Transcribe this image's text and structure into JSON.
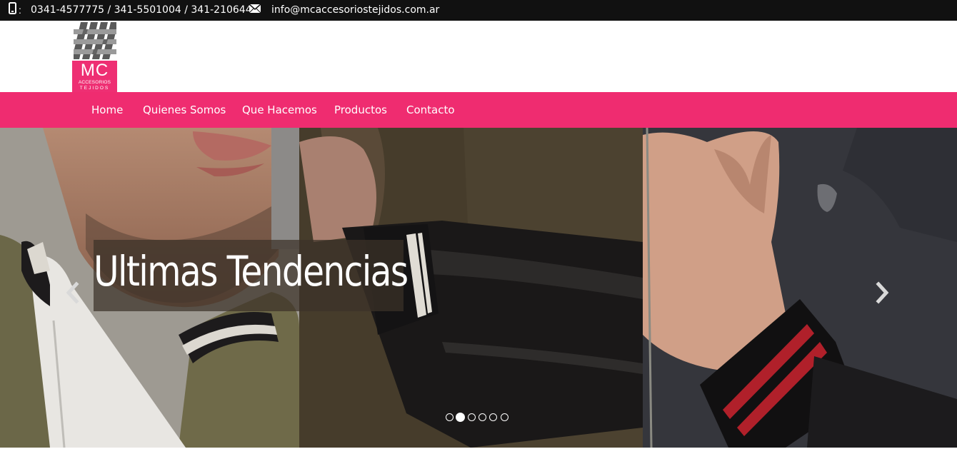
{
  "topbar": {
    "phone_icon": "mobile-phone-icon",
    "phones": "0341-4577775 / 341-5501004 / 341-2106449",
    "mail_icon": "envelope-icon",
    "email": "info@mcaccesoriostejidos.com.ar"
  },
  "logo": {
    "initials": "MC",
    "line1": "ACCESORIOS",
    "line2": "TEJIDOS",
    "brand_color": "#ee2f73"
  },
  "nav": {
    "items": [
      "Home",
      "Quienes Somos",
      "Que Hacemos",
      "Productos",
      "Contacto"
    ],
    "background": "#ef2c70"
  },
  "slider": {
    "caption": "Ultimas Tendencias",
    "prev_icon": "chevron-left-icon",
    "next_icon": "chevron-right-icon",
    "slide_count": 6,
    "active_slide": 2
  }
}
